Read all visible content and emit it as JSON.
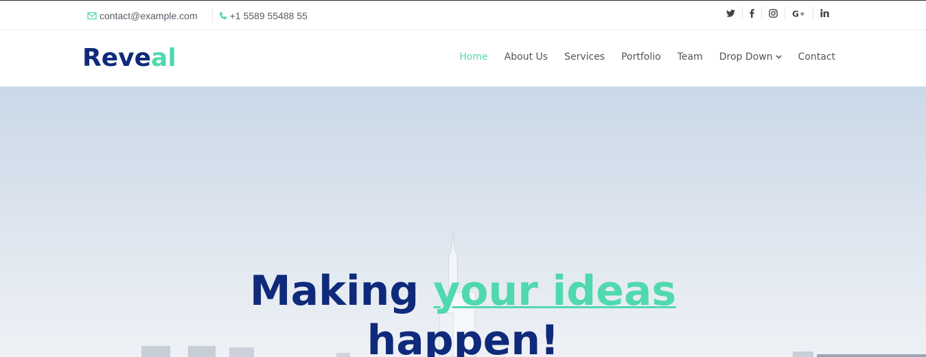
{
  "topbar": {
    "email": "contact@example.com",
    "phone": "+1 5589 55488 55",
    "social": [
      {
        "icon": "twitter-icon",
        "glyph": "t"
      },
      {
        "icon": "facebook-icon",
        "glyph": "f"
      },
      {
        "icon": "instagram-icon",
        "glyph": "◎"
      },
      {
        "icon": "google-plus-icon",
        "glyph": "G+"
      },
      {
        "icon": "linkedin-icon",
        "glyph": "in"
      }
    ]
  },
  "header": {
    "logo_part1": "Reve",
    "logo_part2": "al",
    "nav": [
      {
        "label": "Home",
        "active": true
      },
      {
        "label": "About Us"
      },
      {
        "label": "Services"
      },
      {
        "label": "Portfolio"
      },
      {
        "label": "Team"
      },
      {
        "label": "Drop Down",
        "has_dropdown": true
      },
      {
        "label": "Contact"
      }
    ]
  },
  "hero": {
    "title_part1": "Making ",
    "title_accent": "your ideas",
    "title_part2": "happen!"
  },
  "colors": {
    "brand_dark": "#0f2a7a",
    "accent": "#50d8af",
    "text": "#535353"
  }
}
